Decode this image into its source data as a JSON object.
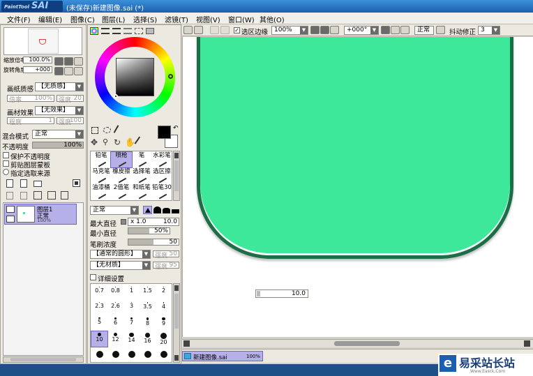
{
  "titlebar": {
    "logo_small": "PaintTool",
    "logo_big": "SAI",
    "title": "(未保存)新建图像.sai (*)"
  },
  "menu": [
    "文件(F)",
    "编辑(E)",
    "图像(C)",
    "图层(L)",
    "选择(S)",
    "滤镜(T)",
    "视图(V)",
    "窗口(W)",
    "其他(O)"
  ],
  "navigator": {
    "zoom_label": "缩放倍率",
    "zoom_value": "100.0%",
    "angle_label": "旋转角度",
    "angle_value": "+000"
  },
  "paper_texture": {
    "label": "画纸质感",
    "value": "【无质感】",
    "sub1_label": "倍率",
    "sub1_value": "100%",
    "sub2_label": "强度",
    "sub2_value": "20"
  },
  "paper_effect": {
    "label": "画材效果",
    "value": "【无效果】",
    "sub1_label": "程度",
    "sub1_value": "1",
    "sub2_label": "强度",
    "sub2_value": "100"
  },
  "blend": {
    "mode_label": "混合模式",
    "mode_value": "正常",
    "opacity_label": "不透明度",
    "opacity_value": "100%",
    "opacity": 1.0
  },
  "layer_options": [
    "保护不透明度",
    "剪贴图层蒙板",
    "指定选取来源"
  ],
  "layer": {
    "name": "图层1",
    "mode": "正常",
    "opacity": "100%"
  },
  "color": {
    "primary": "#000000",
    "secondary": "#ffffff",
    "accent": "#3ee89a"
  },
  "tools": [
    {
      "name": "铅笔"
    },
    {
      "name": "喷枪"
    },
    {
      "name": "笔"
    },
    {
      "name": "水彩笔"
    },
    {
      "name": "马克笔"
    },
    {
      "name": "橡皮擦"
    },
    {
      "name": "选择笔"
    },
    {
      "name": "选区擦"
    },
    {
      "name": "油漆桶"
    },
    {
      "name": "2值笔"
    },
    {
      "name": "和纸笔"
    },
    {
      "name": "铅笔30"
    }
  ],
  "brush": {
    "mode": "正常",
    "max_size_label": "最大直径",
    "max_size_mult": "x 1.0",
    "max_size_value": "10.0",
    "min_size_label": "最小直径",
    "min_size_value": "50%",
    "min_size": 0.5,
    "density_label": "笔刷浓度",
    "density_value": "50",
    "density": 0.5,
    "shape_value": "【通常的圆形】",
    "shape_strength_label": "强度",
    "shape_strength_value": "50",
    "texture_value": "【无材质】",
    "texture_strength_label": "强度",
    "texture_strength_value": "95",
    "details_label": "详细设置"
  },
  "brush_sizes": [
    "0.7",
    "0.8",
    "1",
    "1.5",
    "2",
    "2.3",
    "2.6",
    "3",
    "3.5",
    "4",
    "5",
    "6",
    "7",
    "8",
    "9",
    "10",
    "12",
    "14",
    "16",
    "20"
  ],
  "toolbar": {
    "selection_edge_label": "选区边缘",
    "zoom": "100%",
    "angle": "+000°",
    "mode": "正常",
    "stabilizer_label": "抖动修正",
    "stabilizer_value": "3"
  },
  "canvas": {
    "size_readout": "10.0"
  },
  "tab": {
    "name": "新建图像.sai",
    "zoom": "100%"
  },
  "watermark": {
    "text": "易采站长站",
    "url": "Www.Easck.Com"
  }
}
